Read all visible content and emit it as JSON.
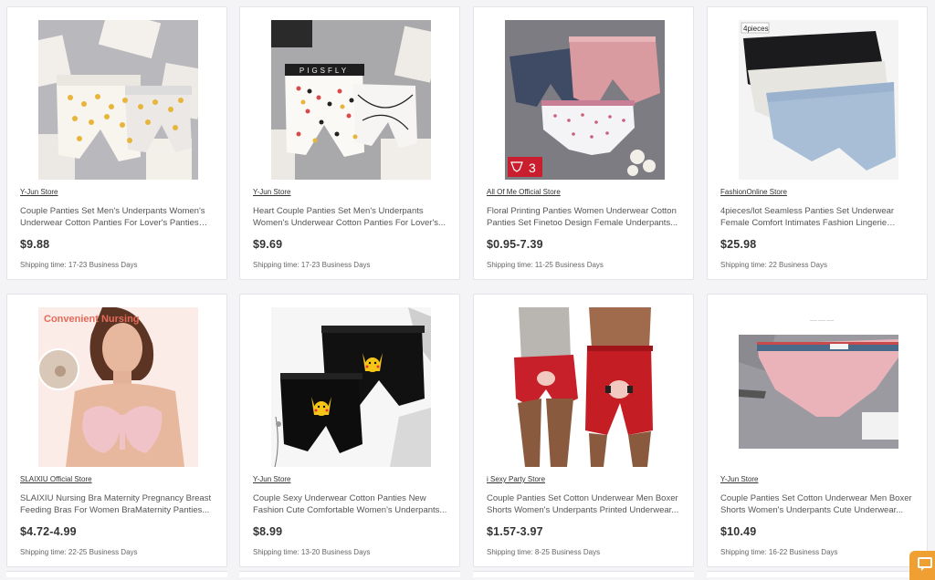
{
  "products": [
    {
      "store": "Y-Jun Store",
      "title": "Couple Panties Set Men's Underpants Women's Underwear Cotton Panties For Lover's Panties Fru...",
      "price": "$9.88",
      "shipping": "Shipping time: 17-23 Business Days",
      "badge": ""
    },
    {
      "store": "Y-Jun Store",
      "title": "Heart Couple Panties Set Men's Underpants Women's Underwear Cotton Panties For Lover's...",
      "price": "$9.69",
      "shipping": "Shipping time: 17-23 Business Days",
      "badge": "PIGSFLY"
    },
    {
      "store": "All Of Me Official Store",
      "title": "Floral Printing Panties Women Underwear Cotton Panties Set Finetoo Design Female Underpants...",
      "price": "$0.95-7.39",
      "shipping": "Shipping time: 11-25 Business Days",
      "badge": "3"
    },
    {
      "store": "FashionOnline Store",
      "title": "4pieces/lot Seamless Panties Set Underwear Female Comfort Intimates Fashion Lingerie Women...",
      "price": "$25.98",
      "shipping": "Shipping time: 22 Business Days",
      "badge": "4pieces"
    },
    {
      "store": "SLAIXIU Official Store",
      "title": "SLAIXIU Nursing Bra Maternity Pregnancy Breast Feeding Bras For Women BraMaternity Panties...",
      "price": "$4.72-4.99",
      "shipping": "Shipping time: 22-25 Business Days",
      "badge": "Convenient Nursing"
    },
    {
      "store": "Y-Jun Store",
      "title": "Couple Sexy Underwear Cotton Panties New Fashion Cute Comfortable Women's Underpants...",
      "price": "$8.99",
      "shipping": "Shipping time: 13-20 Business Days",
      "badge": ""
    },
    {
      "store": "i Sexy Party Store",
      "title": "Couple Panties Set Cotton Underwear Men Boxer Shorts Women's Underpants Printed Underwear...",
      "price": "$1.57-3.97",
      "shipping": "Shipping time: 8-25 Business Days",
      "badge": ""
    },
    {
      "store": "Y-Jun Store",
      "title": "Couple Panties Set Cotton Underwear Men Boxer Shorts Women's Underpants Cute Underwear...",
      "price": "$10.49",
      "shipping": "Shipping time: 16-22 Business Days",
      "badge": ""
    }
  ],
  "colors": {
    "accent": "#f0a033",
    "price": "#333333",
    "border": "#e3e3e8"
  },
  "chat_icon": "chat-bubble-icon"
}
